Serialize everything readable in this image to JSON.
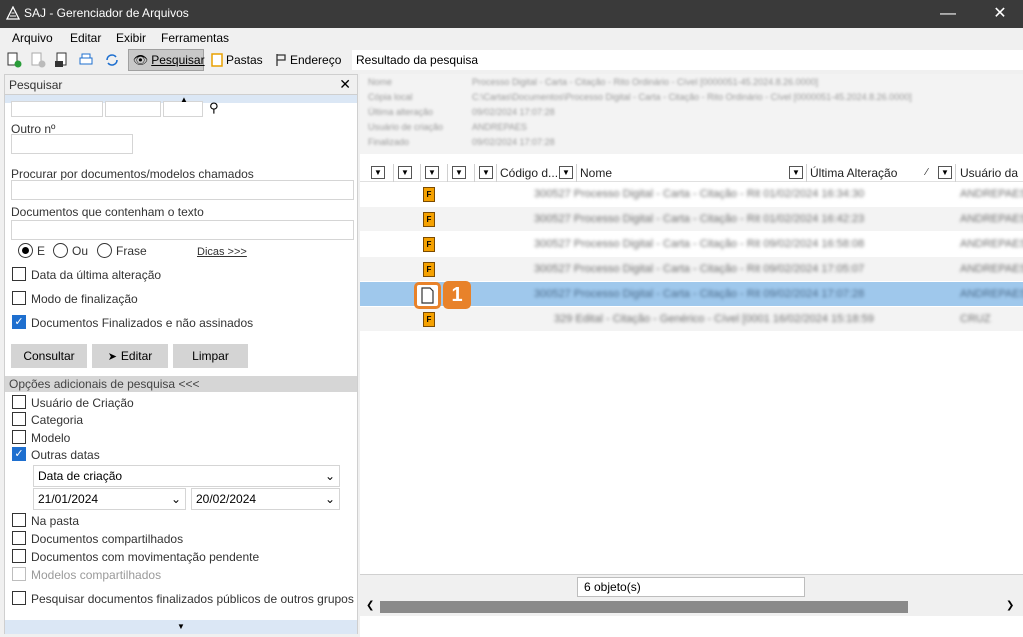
{
  "window": {
    "title": "SAJ - Gerenciador de Arquivos"
  },
  "menu": [
    "Arquivo",
    "Editar",
    "Exibir",
    "Ferramentas"
  ],
  "toolbar": {
    "pesquisar": "Pesquisar",
    "pastas": "Pastas",
    "endereco": "Endereço",
    "address_value": "Resultado da pesquisa"
  },
  "search_panel": {
    "title": "Pesquisar",
    "outro_label": "Outro nº",
    "procurar_label": "Procurar por documentos/modelos chamados",
    "contenham_label": "Documentos que contenham o texto",
    "radio": [
      {
        "label": "E",
        "checked": true
      },
      {
        "label": "Ou",
        "checked": false
      },
      {
        "label": "Frase",
        "checked": false
      }
    ],
    "dicas": "Dicas >>>",
    "checks": [
      {
        "label": "Data da última alteração",
        "checked": false
      },
      {
        "label": "Modo de finalização",
        "checked": false
      },
      {
        "label": "Documentos Finalizados e não assinados",
        "checked": true
      }
    ],
    "buttons": {
      "consultar": "Consultar",
      "editar": "Editar",
      "limpar": "Limpar"
    },
    "opcoes_title": "Opções adicionais de pesquisa <<<",
    "opcoes": [
      {
        "label": "Usuário de Criação",
        "checked": false
      },
      {
        "label": "Categoria",
        "checked": false
      },
      {
        "label": "Modelo",
        "checked": false
      },
      {
        "label": "Outras datas",
        "checked": true
      }
    ],
    "data_tipo": "Data de criação",
    "data_inicio": "21/01/2024",
    "data_fim": "20/02/2024",
    "opcoes2": [
      {
        "label": "Na pasta",
        "checked": false,
        "disabled": false
      },
      {
        "label": "Documentos compartilhados",
        "checked": false,
        "disabled": false
      },
      {
        "label": "Documentos com movimentação pendente",
        "checked": false,
        "disabled": false
      },
      {
        "label": "Modelos compartilhados",
        "checked": false,
        "disabled": true
      },
      {
        "label": "Pesquisar documentos finalizados públicos de outros grupos",
        "checked": false,
        "disabled": false
      }
    ]
  },
  "details": [
    {
      "k": "Nome",
      "v": "Processo Digital - Carta - Citação - Rito Ordinário - Cível [0000051-45.2024.8.26.0000]"
    },
    {
      "k": "Cópia local",
      "v": "C:\\Cartas\\Documentos\\Processo Digital - Carta - Citação - Rito Ordinário - Cível [0000051-45.2024.8.26.0000]"
    },
    {
      "k": "Última alteração",
      "v": "09/02/2024 17:07:28"
    },
    {
      "k": "Usuário de criação",
      "v": "ANDREPAES"
    },
    {
      "k": "Finalizado",
      "v": "09/02/2024 17:07:28"
    }
  ],
  "columns": {
    "codigo": "Código d...",
    "nome": "Nome",
    "ultima": "Última Alteração",
    "usuario": "Usuário da"
  },
  "rows": [
    {
      "text": "300527 Processo Digital - Carta - Citação - Rit 01/02/2024 16:34:30",
      "user": "ANDREPAES",
      "icon": "F"
    },
    {
      "text": "300527 Processo Digital - Carta - Citação - Rit 01/02/2024 16:42:23",
      "user": "ANDREPAES",
      "icon": "F"
    },
    {
      "text": "300527 Processo Digital - Carta - Citação - Rit 09/02/2024 16:58:08",
      "user": "ANDREPAES",
      "icon": "F"
    },
    {
      "text": "300527 Processo Digital - Carta - Citação - Rit 09/02/2024 17:05:07",
      "user": "ANDREPAES",
      "icon": "F"
    },
    {
      "text": "300527 Processo Digital - Carta - Citação - Rit 09/02/2024 17:07:28",
      "user": "ANDREPAES",
      "icon": ""
    },
    {
      "text": "329 Edital - Citação - Genérico - Cível [0001 16/02/2024 15:18:59",
      "user": "CRUZ",
      "icon": "F"
    }
  ],
  "status": "6 objeto(s)",
  "badge": "1"
}
